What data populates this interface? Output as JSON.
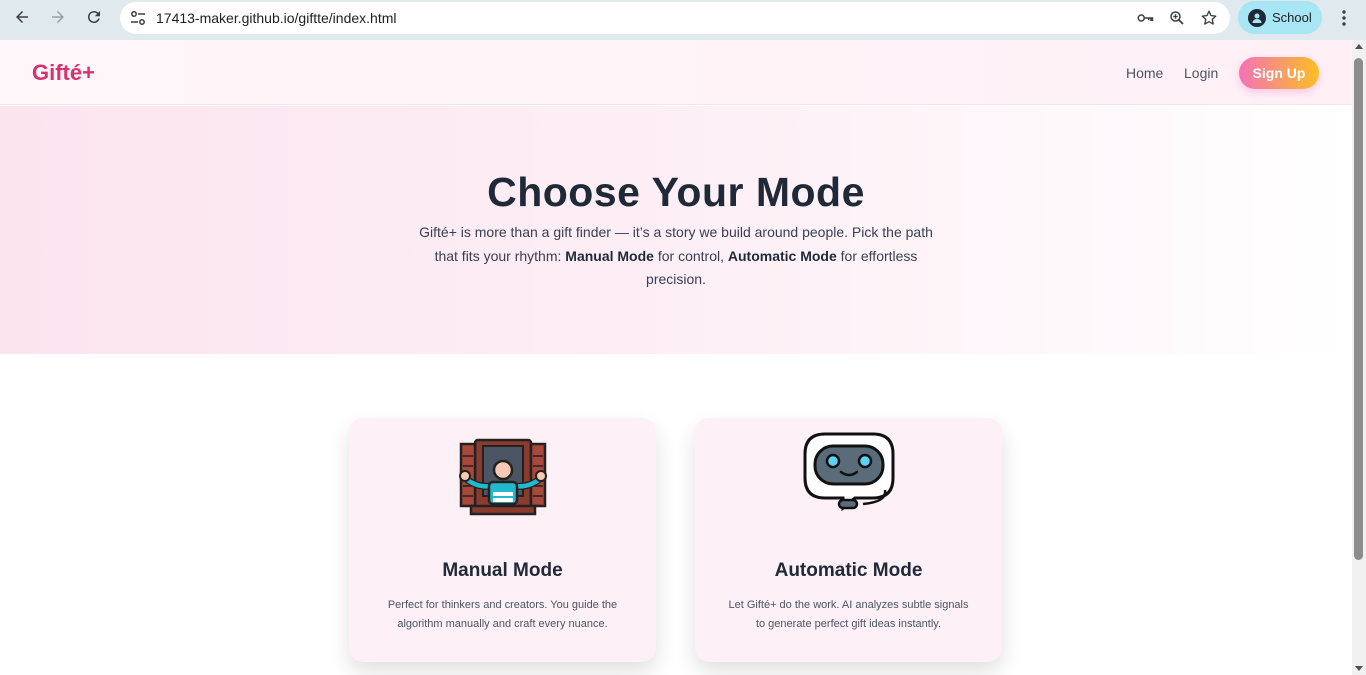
{
  "browser": {
    "url": "17413-maker.github.io/giftte/index.html",
    "profile_label": "School",
    "icons": [
      "back-icon",
      "forward-icon",
      "reload-icon",
      "site-info-icon",
      "key-icon",
      "zoom-icon",
      "star-icon",
      "profile-icon",
      "menu-icon"
    ]
  },
  "header": {
    "logo": "Gifté+",
    "nav": {
      "home": "Home",
      "login": "Login"
    },
    "signup": "Sign Up"
  },
  "hero": {
    "title": "Choose Your Mode",
    "text_1": "Gifté+ is more than a gift finder — it’s a story we build around people. Pick the path that fits your rhythm: ",
    "manual_strong": "Manual Mode",
    "text_2": " for control, ",
    "auto_strong": "Automatic Mode",
    "text_3": " for effortless precision."
  },
  "cards": [
    {
      "title": "Manual Mode",
      "description": "Perfect for thinkers and creators. You guide the algorithm manually and craft every nuance.",
      "icon": "person-at-window-icon"
    },
    {
      "title": "Automatic Mode",
      "description": "Let Gifté+ do the work. AI analyzes subtle signals to generate perfect gift ideas instantly.",
      "icon": "robot-chat-icon"
    }
  ],
  "colors": {
    "brand": "#d6336c",
    "gradient_start": "#f472b6",
    "gradient_end": "#fbbf24",
    "card_bg": "#fdf0f6"
  }
}
